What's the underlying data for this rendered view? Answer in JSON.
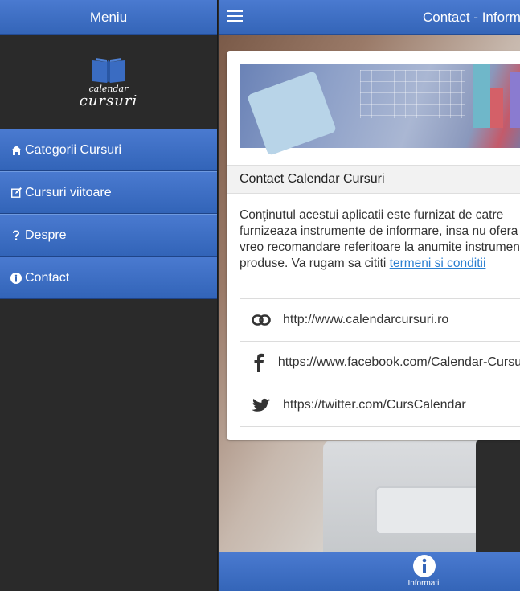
{
  "menu": {
    "title": "Meniu",
    "logo": {
      "line1": "calendar",
      "line2": "cursuri"
    },
    "items": [
      {
        "label": "Categorii Cursuri",
        "icon": "home-icon"
      },
      {
        "label": "Cursuri viitoare",
        "icon": "edit-icon"
      },
      {
        "label": "Despre",
        "icon": "question-icon"
      },
      {
        "label": "Contact",
        "icon": "info-icon"
      }
    ]
  },
  "header": {
    "title": "Contact - Informatii"
  },
  "content": {
    "card_title": "Contact Calendar Cursuri",
    "paragraph_lines": [
      "Conţinutul acestui aplicatii este furnizat de catre",
      "furnizeaza instrumente de informare, insa nu ofera",
      "vreo recomandare referitoare la anumite instrumente",
      "produse. Va rugam sa cititi "
    ],
    "terms_link": "termeni si conditii",
    "links": [
      {
        "icon": "link-icon",
        "text": "http://www.calendarcursuri.ro"
      },
      {
        "icon": "facebook-icon",
        "text": "https://www.facebook.com/Calendar-Cursuri"
      },
      {
        "icon": "twitter-icon",
        "text": "https://twitter.com/CursCalendar"
      }
    ]
  },
  "tabbar": {
    "info_label": "Informatii"
  },
  "colors": {
    "accent": "#3a6cc2",
    "link": "#2b7fd0",
    "sidebar_bg": "#2a2a2a"
  }
}
